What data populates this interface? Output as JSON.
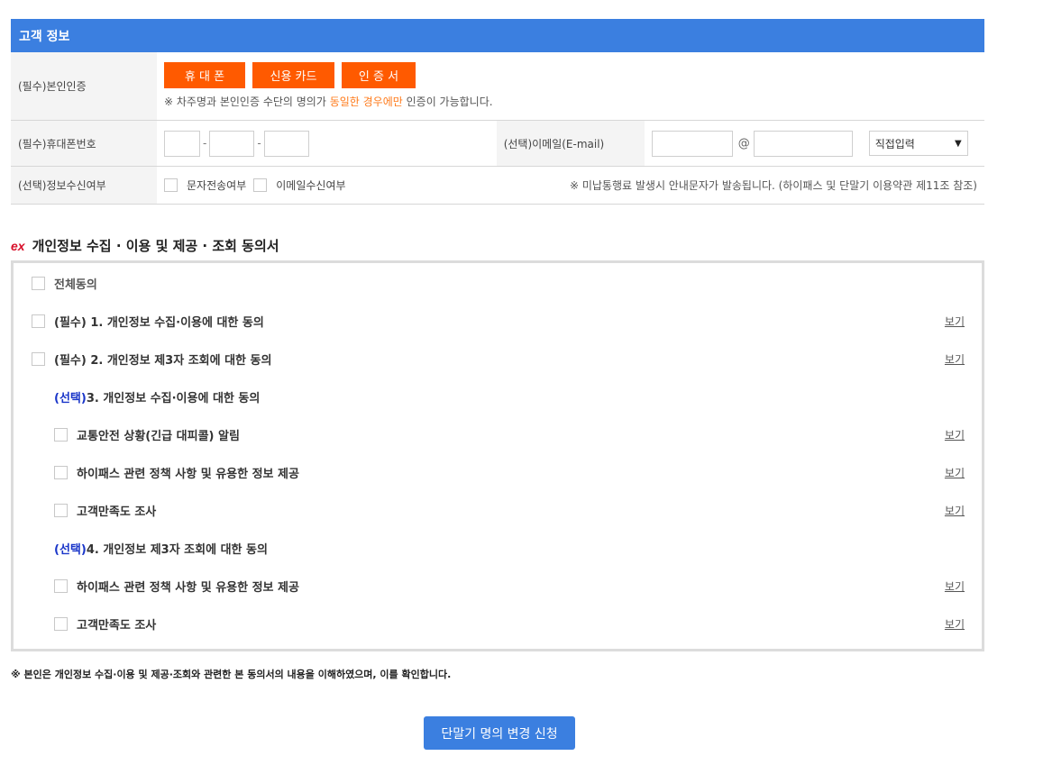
{
  "customer": {
    "header": "고객 정보",
    "auth": {
      "label": "(필수)본인인증",
      "buttons": [
        "휴 대 폰",
        "신용 카드",
        "인 증 서"
      ],
      "notice_pre": "※ 차주명과 본인인증 수단의 명의가 ",
      "notice_highlight": "동일한 경우에만",
      "notice_post": " 인증이 가능합니다."
    },
    "phone": {
      "label": "(필수)휴대폰번호",
      "dash": "-"
    },
    "email": {
      "label": "(선택)이메일(E-mail)",
      "at": "@",
      "select_value": "직접입력"
    },
    "receive": {
      "label": "(선택)정보수신여부",
      "sms": "문자전송여부",
      "email": "이메일수신여부",
      "notice": "※ 미납통행료 발생시 안내문자가 발송됩니다. (하이패스 및 단말기 이용약관 제11조 참조)"
    }
  },
  "consent": {
    "logo": "ex",
    "title": "개인정보 수집 · 이용 및 제공 · 조회 동의서",
    "view_label": "보기",
    "items": [
      {
        "prefix": "",
        "text": "전체동의"
      },
      {
        "prefix": "",
        "text": "(필수) 1. 개인정보 수집·이용에 대한 동의"
      },
      {
        "prefix": "",
        "text": "(필수) 2. 개인정보 제3자 조회에 대한 동의"
      },
      {
        "prefix": "(선택)",
        "text": " 3. 개인정보 수집·이용에 대한 동의"
      },
      {
        "prefix": "",
        "text": "교통안전 상황(긴급 대피콜) 알림"
      },
      {
        "prefix": "",
        "text": "하이패스 관련 정책 사항 및 유용한 정보 제공"
      },
      {
        "prefix": "",
        "text": "고객만족도 조사"
      },
      {
        "prefix": "(선택)",
        "text": " 4. 개인정보 제3자 조회에 대한 동의"
      },
      {
        "prefix": "",
        "text": "하이패스 관련 정책 사항 및 유용한 정보 제공"
      },
      {
        "prefix": "",
        "text": "고객만족도 조사"
      }
    ]
  },
  "footer": {
    "note": "※ 본인은 개인정보 수집·이용 및 제공·조회와 관련한 본 동의서의 내용을 이해하였으며, 이를 확인합니다.",
    "submit": "단말기 명의 변경 신청"
  },
  "colors": {
    "primary": "#3b7fe0",
    "orange": "#ff5a00",
    "highlight": "#ff7a1a",
    "select_blue": "#1a36c9"
  }
}
